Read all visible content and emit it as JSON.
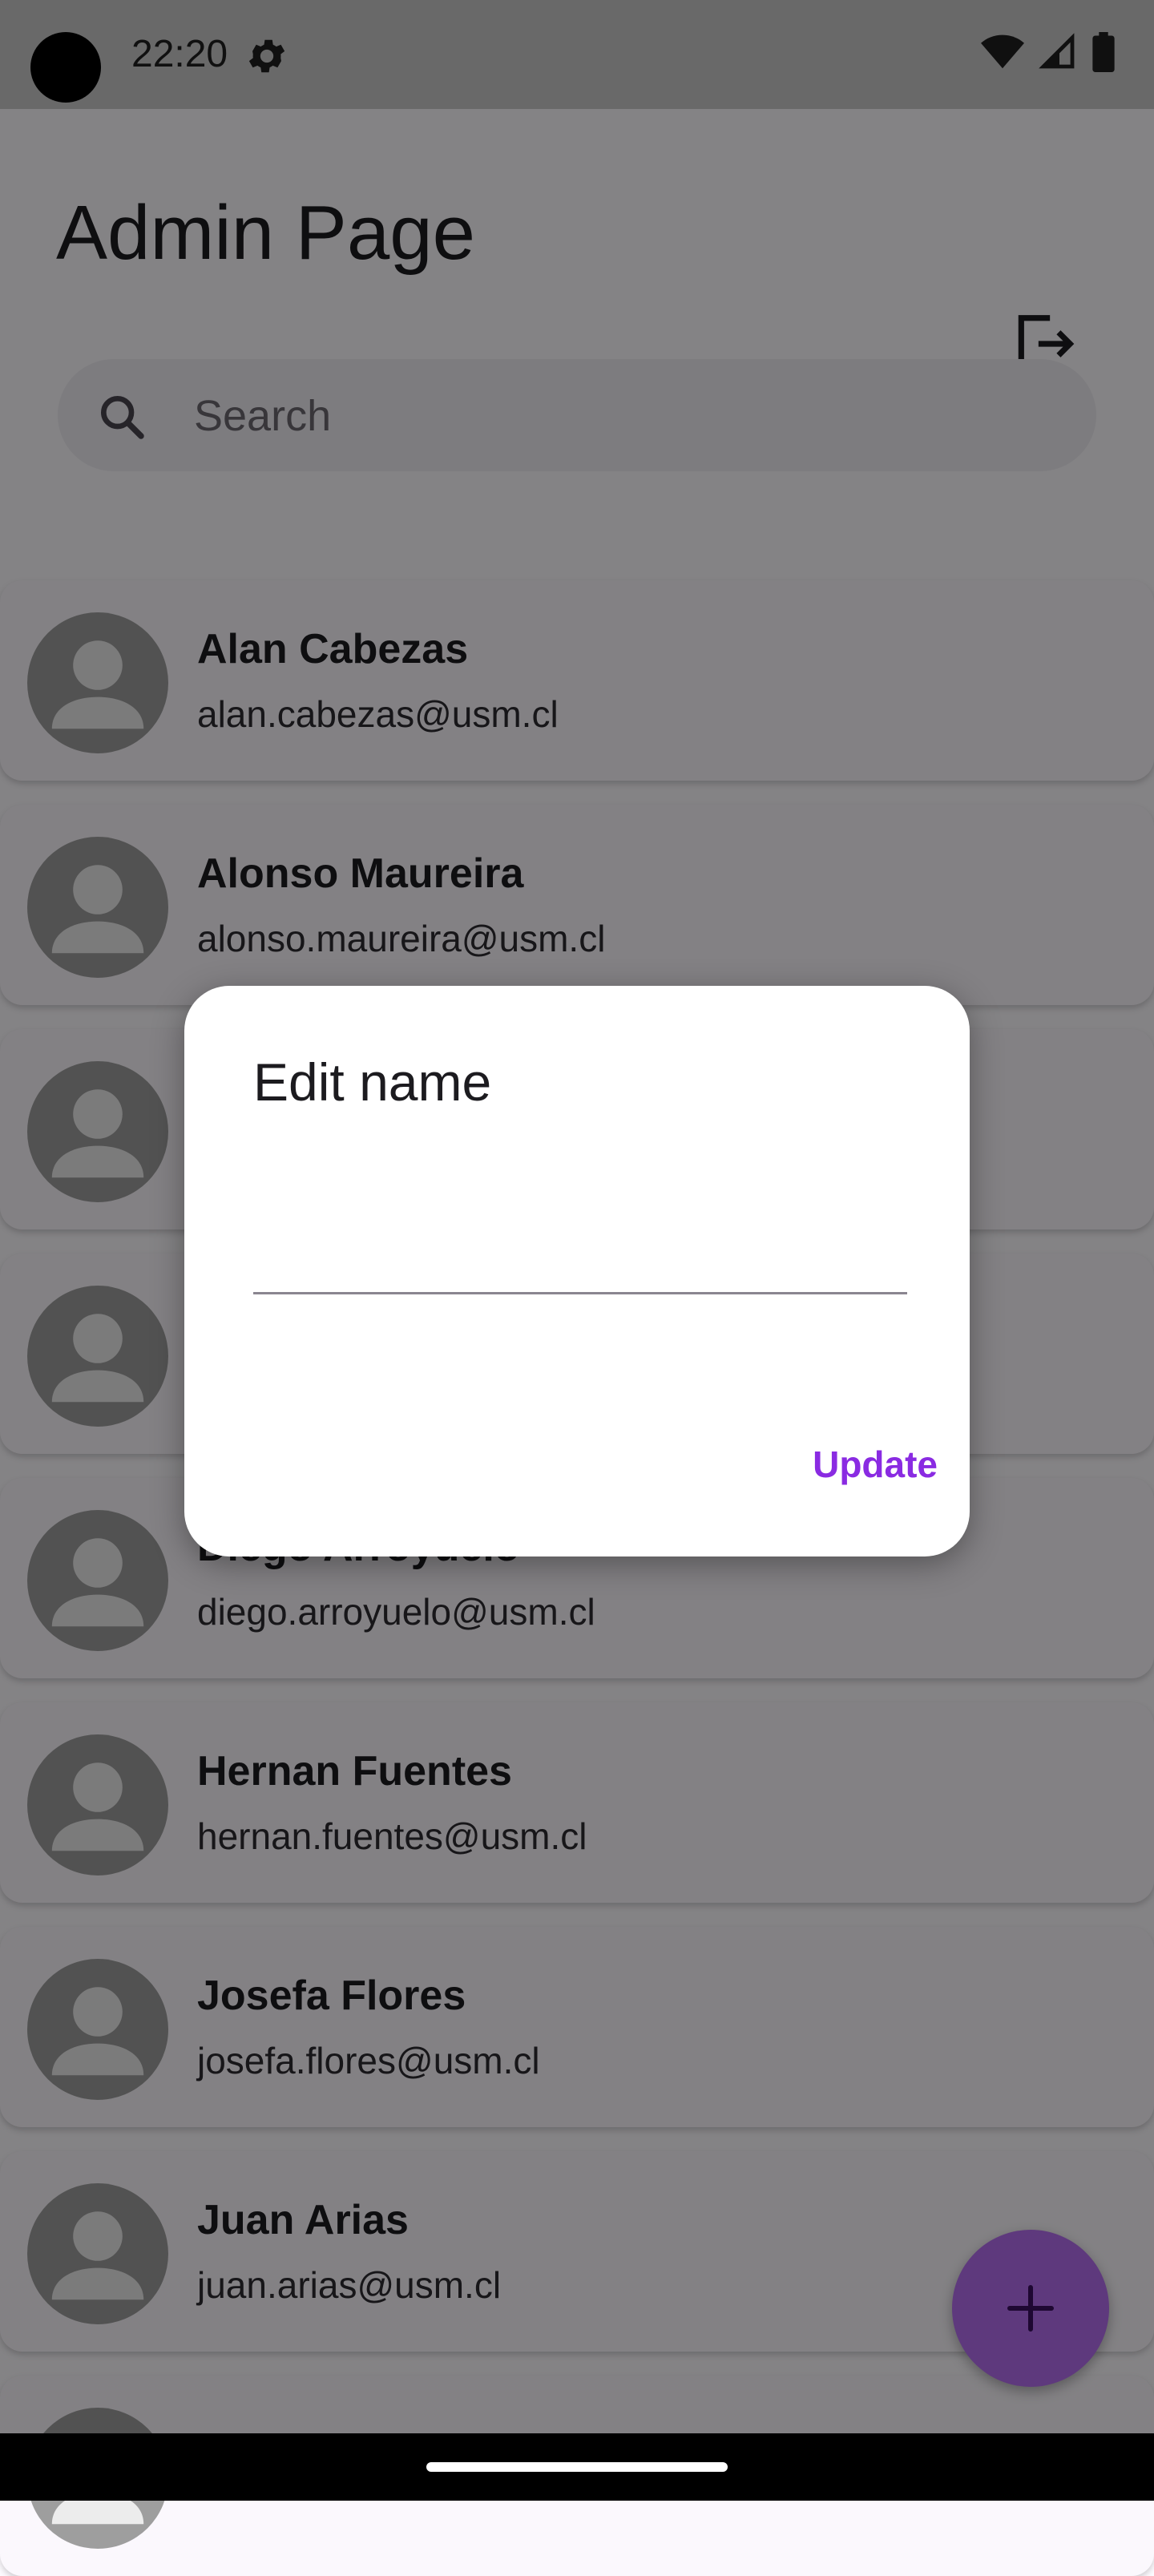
{
  "status_bar": {
    "time": "22:20"
  },
  "header": {
    "title": "Admin Page"
  },
  "search": {
    "placeholder": "Search"
  },
  "users": [
    {
      "name": "Alan Cabezas",
      "email": "alan.cabezas@usm.cl"
    },
    {
      "name": "Alonso Maureira",
      "email": "alonso.maureira@usm.cl"
    },
    {
      "name": "",
      "email": ""
    },
    {
      "name": "",
      "email": ""
    },
    {
      "name": "Diego Arroyuelo",
      "email": "diego.arroyuelo@usm.cl"
    },
    {
      "name": "Hernan Fuentes",
      "email": "hernan.fuentes@usm.cl"
    },
    {
      "name": "Josefa Flores",
      "email": "josefa.flores@usm.cl"
    },
    {
      "name": "Juan Arias",
      "email": "juan.arias@usm.cl"
    }
  ],
  "dialog": {
    "title": "Edit name",
    "input_value": "",
    "update_label": "Update"
  },
  "icons": {
    "settings": "gear-icon",
    "wifi": "wifi-icon",
    "signal": "signal-icon",
    "battery": "battery-icon",
    "logout": "logout-icon",
    "search": "search-icon",
    "avatar": "person-icon",
    "fab": "plus-icon"
  },
  "colors": {
    "accent": "#8a2be2",
    "fab": "#b46ef0",
    "scrim": "rgba(0,0,0,0.48)"
  }
}
